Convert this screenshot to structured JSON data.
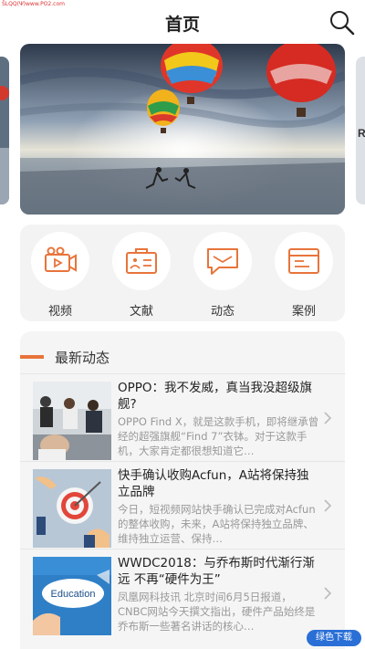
{
  "status_watermark": "ŠLQQ(Ψ)www.PO2.com",
  "header": {
    "title": "首页",
    "search_icon": "search-icon"
  },
  "carousel": {
    "current_index": 2,
    "total": 3
  },
  "menu": {
    "items": [
      {
        "label": "视频",
        "icon": "video-camera-icon"
      },
      {
        "label": "文献",
        "icon": "document-card-icon"
      },
      {
        "label": "动态",
        "icon": "message-bubble-icon"
      },
      {
        "label": "案例",
        "icon": "case-file-icon"
      }
    ],
    "accent_color": "#e8743b"
  },
  "news": {
    "section_title": "最新动态",
    "items": [
      {
        "headline": "OPPO：我不发威，真当我没超级旗舰?",
        "summary": "OPPO Find X，就是这款手机，即将继承曾经的超强旗舰“Find 7”衣钵。对于这款手机，大家肯定都很想知道它…"
      },
      {
        "headline": "快手确认收购Acfun，A站将保持独立品牌",
        "summary": "今日，短视频网站快手确认已完成对Acfun的整体收购，未来，A站将保持独立品牌、维持独立运营、保持…"
      },
      {
        "headline": "WWDC2018：与乔布斯时代渐行渐远 不再“硬件为王”",
        "summary": "凤凰网科技讯 北京时间6月5日报道，CNBC网站今天撰文指出，硬件产品始终是乔布斯一些著名讲话的核心…",
        "thumb_text": "Education"
      }
    ]
  },
  "corner_logo": "绿色下载"
}
